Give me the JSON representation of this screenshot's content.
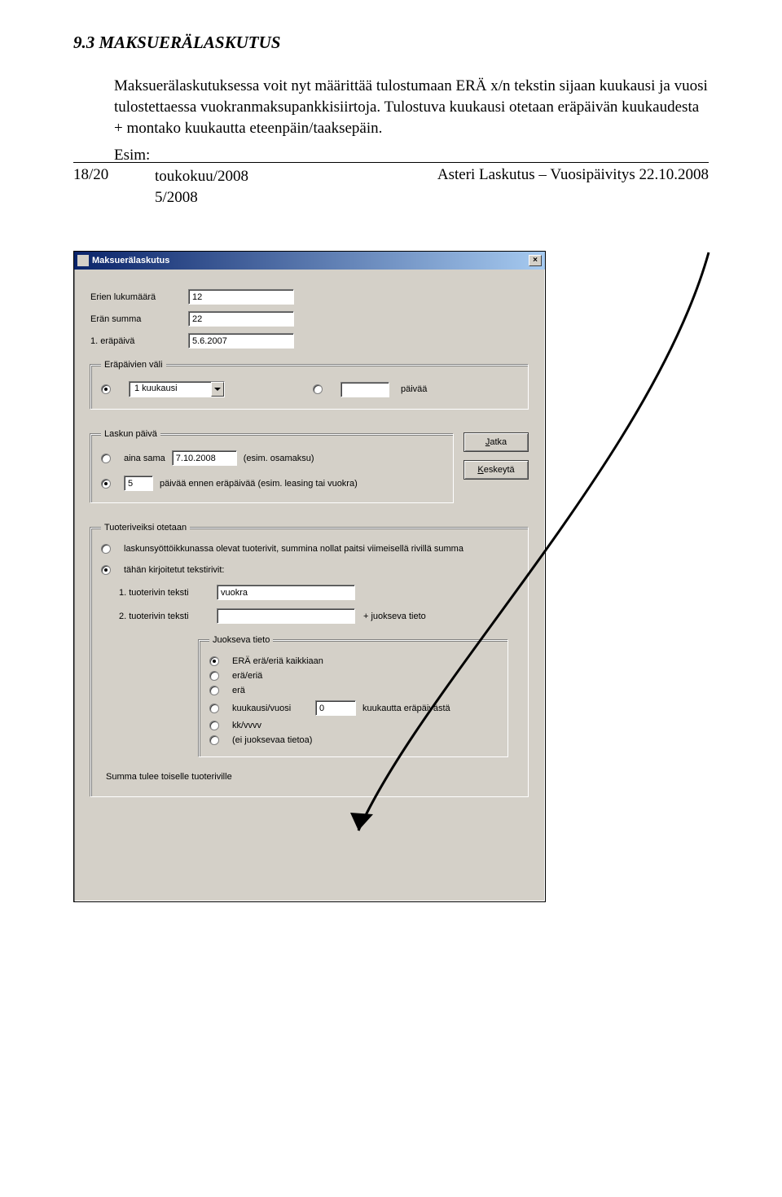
{
  "section": {
    "title": "9.3 MAKSUERÄLASKUTUS"
  },
  "para_text": "Maksuerälaskutuksessa voit nyt määrittää tulostumaan ERÄ x/n tekstin sijaan kuukausi ja vuosi tulostettaessa vuokranmaksupankkisiirtoja. Tulostuva kuukausi otetaan eräpäivän kuukaudesta + montako kuukautta eteenpäin/taaksepäin.",
  "example": {
    "intro": "Esim:",
    "line1": "toukokuu/2008",
    "line2": "5/2008"
  },
  "dialog": {
    "title": "Maksuerälaskutus",
    "labels": {
      "erien_lukumaara": "Erien lukumäärä",
      "eran_summa": "Erän summa",
      "ensimmainen_erapaiva": "1. eräpäivä"
    },
    "values": {
      "erien_lukumaara": "12",
      "eran_summa": "22",
      "ensimmainen_erapaiva": "5.6.2007",
      "interval_combo": "1 kuukausi",
      "paivaa_input": "",
      "aina_sama_date": "7.10.2008",
      "paivia_ennen": "5",
      "tuoterivi1": "vuokra",
      "tuoterivi2": "",
      "kk_offset": "0"
    },
    "group_erapaivien_vali": {
      "legend": "Eräpäivien väli",
      "paivaa_label": "päivää"
    },
    "group_laskun_paiva": {
      "legend": "Laskun päivä",
      "aina_sama": "aina sama",
      "esim_osamaksu": "(esim. osamaksu)",
      "paivia_ennen_txt": "päivää ennen eräpäivää (esim. leasing tai vuokra)"
    },
    "buttons": {
      "jatka": "Jatka",
      "keskeyta": "Keskeytä"
    },
    "group_tuoteriveiksi": {
      "legend": "Tuoteriveiksi otetaan",
      "opt_laskunsyotto": "laskunsyöttöikkunassa olevat tuoterivit, summina nollat paitsi viimeisellä rivillä summa",
      "opt_tahankirjoitetut": "tähän kirjoitetut tekstirivit:",
      "tuoterivi1_lbl": "1. tuoterivin teksti",
      "tuoterivi2_lbl": "2. tuoterivin teksti",
      "juokseva_suffix": "+ juokseva tieto",
      "juokseva_legend": "Juokseva tieto",
      "juokseva_opts": {
        "era_kaikkiaan": "ERÄ erä/eriä kaikkiaan",
        "era_eria": "erä/eriä",
        "era": "erä",
        "kuukausi_vuosi": "kuukausi/vuosi",
        "kk_vvvv": "kk/vvvv",
        "ei_tietoa": "(ei juoksevaa tietoa)"
      },
      "kk_offset_label": "kuukautta eräpäivästä",
      "summary": "Summa tulee toiselle tuoteriville"
    }
  },
  "footer": {
    "left": "18/20",
    "right": "Asteri Laskutus – Vuosipäivitys 22.10.2008"
  }
}
